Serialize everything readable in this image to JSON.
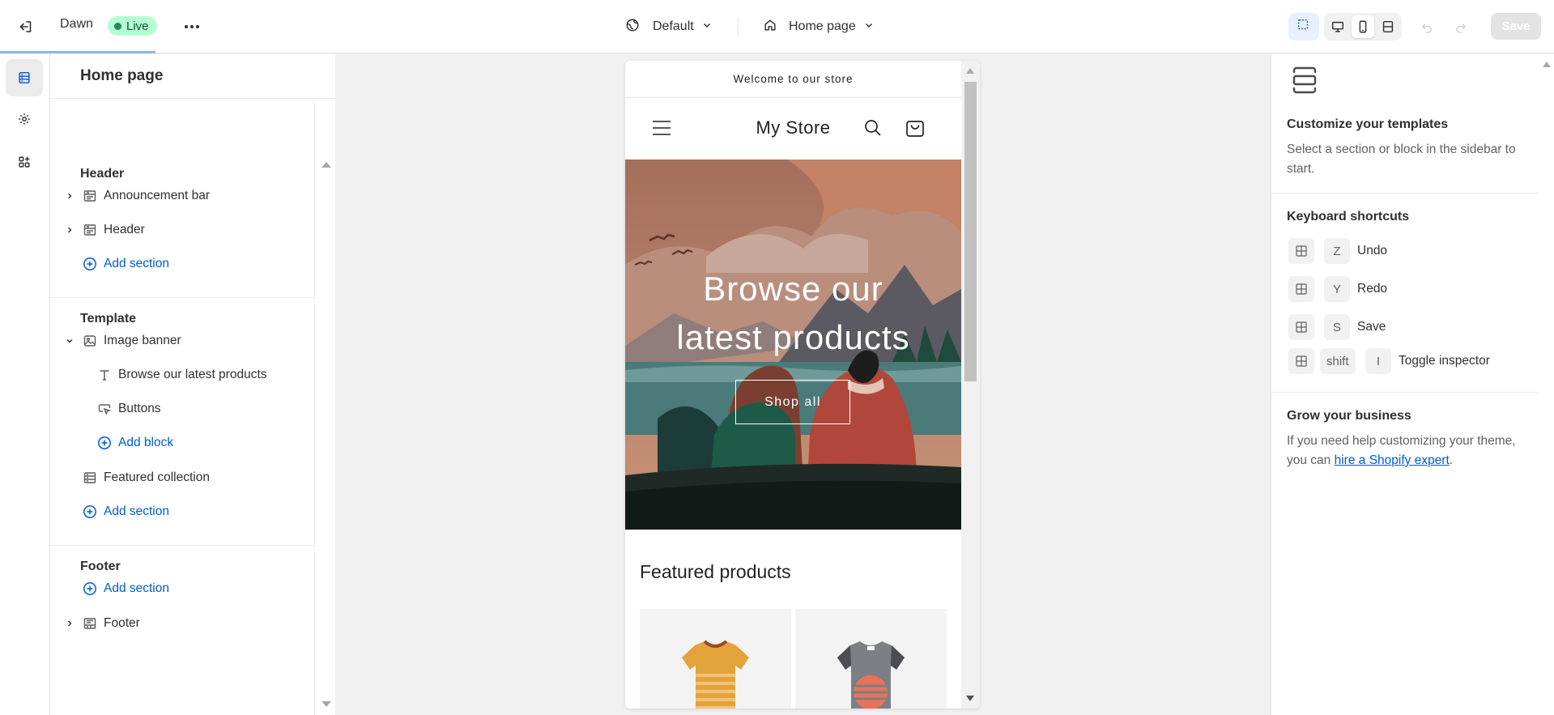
{
  "topbar": {
    "theme_name": "Dawn",
    "live_label": "Live",
    "theme_selector": "Default",
    "page_selector": "Home page",
    "save_label": "Save"
  },
  "sidebar": {
    "title": "Home page",
    "groups": {
      "header": {
        "title": "Header",
        "items": [
          "Announcement bar",
          "Header"
        ],
        "add_label": "Add section"
      },
      "template": {
        "title": "Template",
        "image_banner": "Image banner",
        "blocks": [
          "Browse our latest products",
          "Buttons"
        ],
        "add_block_label": "Add block",
        "featured": "Featured collection",
        "add_label": "Add section"
      },
      "footer": {
        "title": "Footer",
        "add_label": "Add section",
        "items": [
          "Footer"
        ]
      }
    }
  },
  "preview": {
    "announcement": "Welcome to our store",
    "store_name": "My Store",
    "banner_heading_line1": "Browse our",
    "banner_heading_line2": "latest products",
    "shop_button": "Shop all",
    "featured_title": "Featured products"
  },
  "right_panel": {
    "customize_title": "Customize your templates",
    "customize_text": "Select a section or block in the sidebar to start.",
    "shortcuts_title": "Keyboard shortcuts",
    "shortcuts": [
      {
        "key": "Z",
        "label": "Undo"
      },
      {
        "key": "Y",
        "label": "Redo"
      },
      {
        "key": "S",
        "label": "Save"
      },
      {
        "key1": "shift",
        "key2": "I",
        "label": "Toggle inspector"
      }
    ],
    "grow_title": "Grow your business",
    "grow_text_before": "If you need help customizing your theme, you can ",
    "grow_link": "hire a Shopify expert",
    "grow_text_after": "."
  },
  "colors": {
    "accent_blue": "#005bd3",
    "live_green": "#b4fed2"
  }
}
